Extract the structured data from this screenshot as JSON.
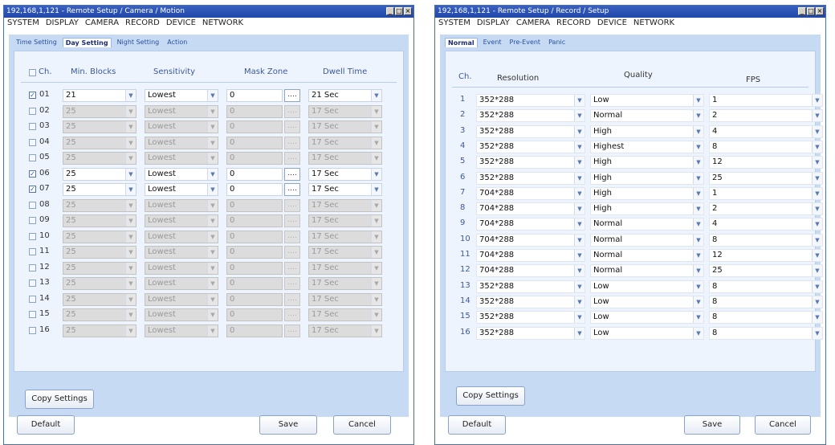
{
  "left": {
    "title": "192,168,1,121 - Remote Setup / Camera / Motion",
    "menu": [
      "SYSTEM",
      "DISPLAY",
      "CAMERA",
      "RECORD",
      "DEVICE",
      "NETWORK"
    ],
    "tabs": [
      "Time Setting",
      "Day Setting",
      "Night Setting",
      "Action"
    ],
    "active_tab": "Day Setting",
    "headers": {
      "ch": "Ch.",
      "blocks": "Min. Blocks",
      "sens": "Sensitivity",
      "mask": "Mask Zone",
      "dwell": "Dwell Time"
    },
    "rows": [
      {
        "ch": "01",
        "checked": true,
        "blocks": "21",
        "sens": "Lowest",
        "mask": "0",
        "dwell": "21 Sec"
      },
      {
        "ch": "02",
        "checked": false,
        "blocks": "25",
        "sens": "Lowest",
        "mask": "0",
        "dwell": "17 Sec"
      },
      {
        "ch": "03",
        "checked": false,
        "blocks": "25",
        "sens": "Lowest",
        "mask": "0",
        "dwell": "17 Sec"
      },
      {
        "ch": "04",
        "checked": false,
        "blocks": "25",
        "sens": "Lowest",
        "mask": "0",
        "dwell": "17 Sec"
      },
      {
        "ch": "05",
        "checked": false,
        "blocks": "25",
        "sens": "Lowest",
        "mask": "0",
        "dwell": "17 Sec"
      },
      {
        "ch": "06",
        "checked": true,
        "blocks": "25",
        "sens": "Lowest",
        "mask": "0",
        "dwell": "17 Sec"
      },
      {
        "ch": "07",
        "checked": true,
        "blocks": "25",
        "sens": "Lowest",
        "mask": "0",
        "dwell": "17 Sec"
      },
      {
        "ch": "08",
        "checked": false,
        "blocks": "25",
        "sens": "Lowest",
        "mask": "0",
        "dwell": "17 Sec"
      },
      {
        "ch": "09",
        "checked": false,
        "blocks": "25",
        "sens": "Lowest",
        "mask": "0",
        "dwell": "17 Sec"
      },
      {
        "ch": "10",
        "checked": false,
        "blocks": "25",
        "sens": "Lowest",
        "mask": "0",
        "dwell": "17 Sec"
      },
      {
        "ch": "11",
        "checked": false,
        "blocks": "25",
        "sens": "Lowest",
        "mask": "0",
        "dwell": "17 Sec"
      },
      {
        "ch": "12",
        "checked": false,
        "blocks": "25",
        "sens": "Lowest",
        "mask": "0",
        "dwell": "17 Sec"
      },
      {
        "ch": "13",
        "checked": false,
        "blocks": "25",
        "sens": "Lowest",
        "mask": "0",
        "dwell": "17 Sec"
      },
      {
        "ch": "14",
        "checked": false,
        "blocks": "25",
        "sens": "Lowest",
        "mask": "0",
        "dwell": "17 Sec"
      },
      {
        "ch": "15",
        "checked": false,
        "blocks": "25",
        "sens": "Lowest",
        "mask": "0",
        "dwell": "17 Sec"
      },
      {
        "ch": "16",
        "checked": false,
        "blocks": "25",
        "sens": "Lowest",
        "mask": "0",
        "dwell": "17 Sec"
      }
    ],
    "mask_button": "....",
    "copy_label": "Copy Settings",
    "default_label": "Default",
    "save_label": "Save",
    "cancel_label": "Cancel"
  },
  "right": {
    "title": "192,168,1,121 - Remote Setup / Record / Setup",
    "menu": [
      "SYSTEM",
      "DISPLAY",
      "CAMERA",
      "RECORD",
      "DEVICE",
      "NETWORK"
    ],
    "tabs": [
      "Normal",
      "Event",
      "Pre-Event",
      "Panic"
    ],
    "active_tab": "Normal",
    "headers": {
      "ch": "Ch.",
      "res": "Resolution",
      "quality": "Quality",
      "fps": "FPS"
    },
    "rows": [
      {
        "ch": "1",
        "res": "352*288",
        "quality": "Low",
        "fps": "1"
      },
      {
        "ch": "2",
        "res": "352*288",
        "quality": "Normal",
        "fps": "2"
      },
      {
        "ch": "3",
        "res": "352*288",
        "quality": "High",
        "fps": "4"
      },
      {
        "ch": "4",
        "res": "352*288",
        "quality": "Highest",
        "fps": "8"
      },
      {
        "ch": "5",
        "res": "352*288",
        "quality": "High",
        "fps": "12"
      },
      {
        "ch": "6",
        "res": "352*288",
        "quality": "High",
        "fps": "25"
      },
      {
        "ch": "7",
        "res": "704*288",
        "quality": "High",
        "fps": "1"
      },
      {
        "ch": "8",
        "res": "704*288",
        "quality": "High",
        "fps": "2"
      },
      {
        "ch": "9",
        "res": "704*288",
        "quality": "Normal",
        "fps": "4"
      },
      {
        "ch": "10",
        "res": "704*288",
        "quality": "Normal",
        "fps": "8"
      },
      {
        "ch": "11",
        "res": "704*288",
        "quality": "Normal",
        "fps": "12"
      },
      {
        "ch": "12",
        "res": "704*288",
        "quality": "Normal",
        "fps": "25"
      },
      {
        "ch": "13",
        "res": "352*288",
        "quality": "Low",
        "fps": "8"
      },
      {
        "ch": "14",
        "res": "352*288",
        "quality": "Low",
        "fps": "8"
      },
      {
        "ch": "15",
        "res": "352*288",
        "quality": "Low",
        "fps": "8"
      },
      {
        "ch": "16",
        "res": "352*288",
        "quality": "Low",
        "fps": "8"
      }
    ],
    "copy_label": "Copy Settings",
    "default_label": "Default",
    "save_label": "Save",
    "cancel_label": "Cancel"
  }
}
